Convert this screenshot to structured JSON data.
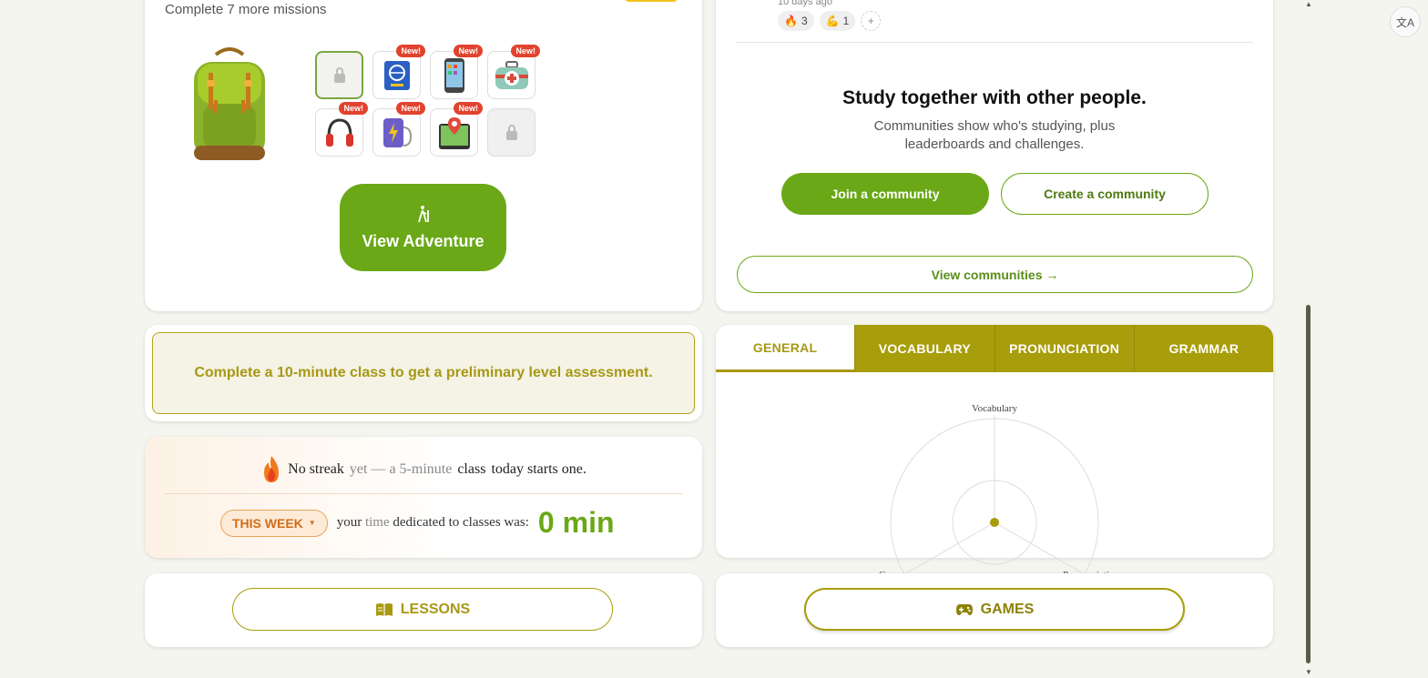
{
  "adventure": {
    "missions_text": "Complete 7 more missions",
    "view_button": "View Adventure",
    "new_label": "New!"
  },
  "community": {
    "time_ago": "10 days ago",
    "reactions": [
      {
        "icon": "🔥",
        "count": "3"
      },
      {
        "icon": "💪",
        "count": "1"
      }
    ],
    "add_reaction": "+",
    "title": "Study together with other people.",
    "subtitle": "Communities show who's studying, plus leaderboards and challenges.",
    "join_button": "Join a community",
    "create_button": "Create a community",
    "view_button": "View communities →"
  },
  "assessment": {
    "text": "Complete a 10-minute class to get a preliminary level assessment."
  },
  "streak": {
    "p1": "No streak",
    "p2": "yet — a 5-minute",
    "p3": "class",
    "p4": "today starts one.",
    "period": "THIS WEEK",
    "time_text_a": "your",
    "time_text_b": "time",
    "time_text_c": "dedicated",
    "time_text_d": "to classes was:",
    "time_value": "0 min"
  },
  "skills": {
    "tabs": [
      "GENERAL",
      "VOCABULARY",
      "PRONUNCIATION",
      "GRAMMAR"
    ],
    "active_tab": "GENERAL",
    "radar_labels": {
      "top": "Vocabulary",
      "left": "Grammar",
      "right": "Pronunciation"
    }
  },
  "bottom": {
    "lessons": "LESSONS",
    "games": "GAMES"
  },
  "colors": {
    "primary_green": "#6aa817",
    "olive": "#a89d0a",
    "orange": "#d06d1a"
  }
}
